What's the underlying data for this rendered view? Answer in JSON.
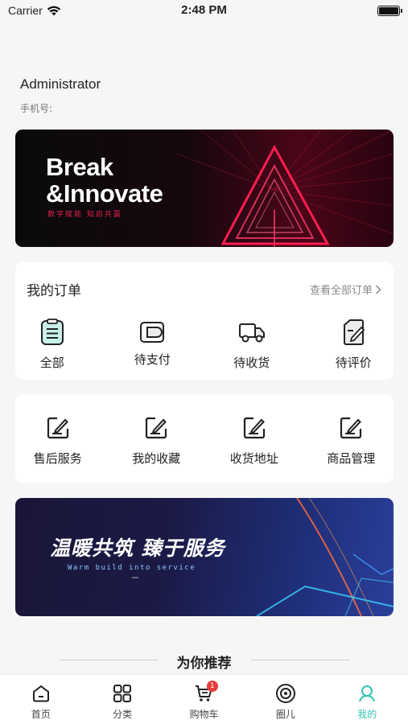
{
  "status_bar": {
    "carrier": "Carrier",
    "time": "2:48 PM"
  },
  "profile": {
    "name": "Administrator",
    "phone_label": "手机号:"
  },
  "banner_top": {
    "title_line1": "Break",
    "title_line2": "&Innovate",
    "subtitle": "数字赋能 知启共赢"
  },
  "orders": {
    "title": "我的订单",
    "view_all": "查看全部订单",
    "items": [
      {
        "label": "全部",
        "icon": "clipboard-icon"
      },
      {
        "label": "待支付",
        "icon": "wallet-icon"
      },
      {
        "label": "待收货",
        "icon": "truck-icon"
      },
      {
        "label": "待评价",
        "icon": "edit-note-icon"
      }
    ]
  },
  "services": {
    "items": [
      {
        "label": "售后服务",
        "icon": "edit-icon"
      },
      {
        "label": "我的收藏",
        "icon": "edit-icon"
      },
      {
        "label": "收货地址",
        "icon": "edit-icon"
      },
      {
        "label": "商品管理",
        "icon": "edit-icon"
      }
    ]
  },
  "banner_bottom": {
    "title": "温暖共筑  臻于服务",
    "subtitle": "Warm build into service"
  },
  "recommend": {
    "title": "为你推荐"
  },
  "tabbar": {
    "items": [
      {
        "label": "首页",
        "icon": "home-icon"
      },
      {
        "label": "分类",
        "icon": "grid-icon"
      },
      {
        "label": "购物车",
        "icon": "cart-icon",
        "badge": "1"
      },
      {
        "label": "圈儿",
        "icon": "circle-icon"
      },
      {
        "label": "我的",
        "icon": "user-icon",
        "active": true
      }
    ]
  },
  "colors": {
    "accent": "#34c3b2",
    "badge": "#e83b3b",
    "background": "#f6f6f6"
  }
}
